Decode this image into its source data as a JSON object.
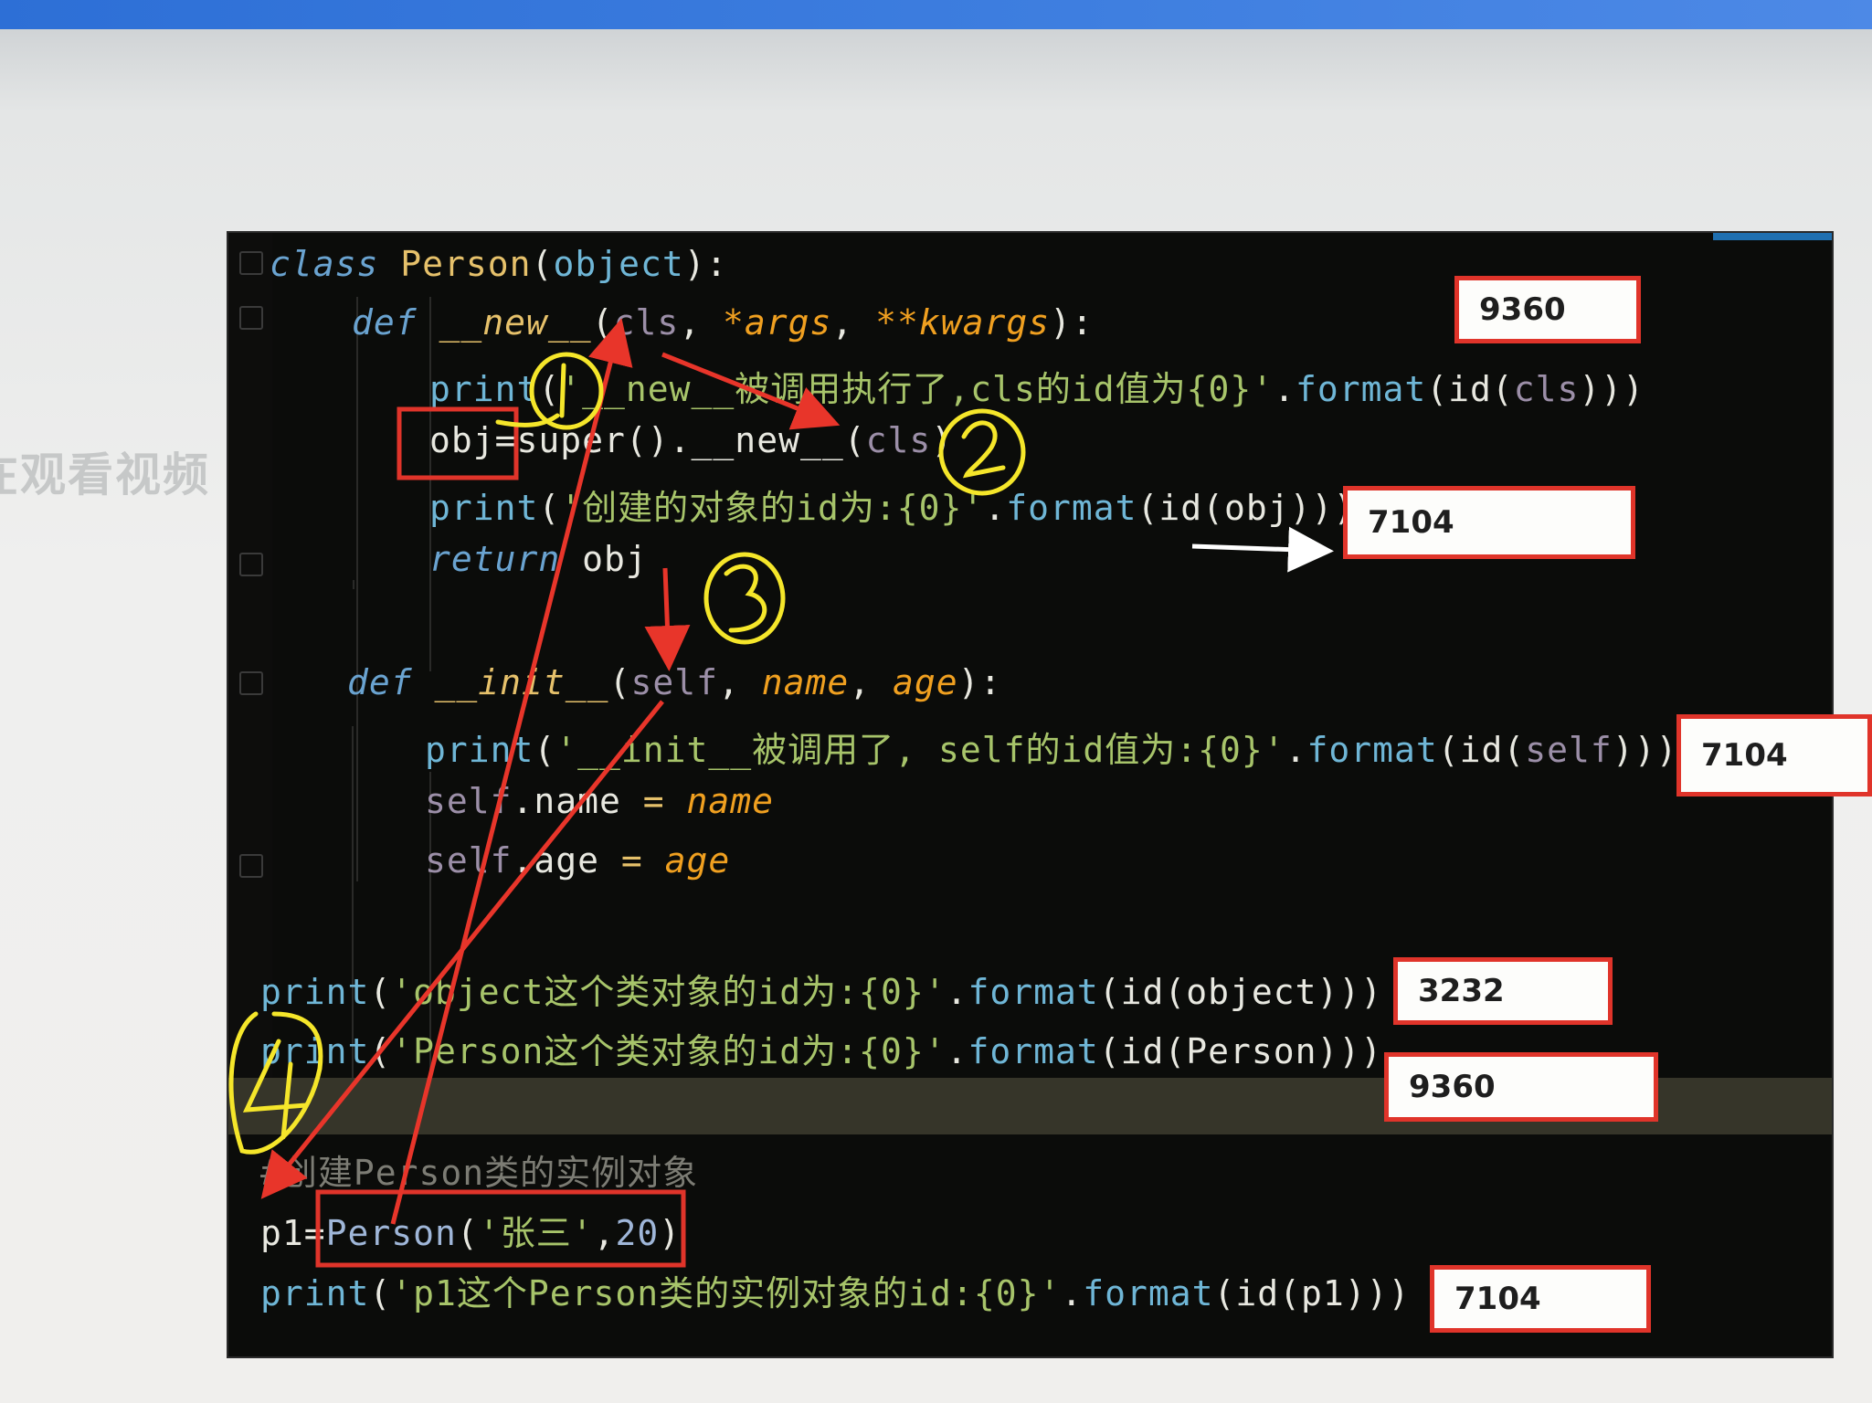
{
  "side_caption": "在观看视频",
  "code": {
    "l1": {
      "kw": "class",
      "name": "Person",
      "open": "(",
      "base": "object",
      "close": "):"
    },
    "l2": {
      "kw": "def",
      "fn": "__new__",
      "open": "(",
      "p1": "cls",
      "comma1": ", ",
      "p2": "*args",
      "comma2": ", ",
      "p3": "**kwargs",
      "close": "):"
    },
    "l3": {
      "print": "print",
      "open": "(",
      "str": "'__new__被调用执行了,cls的id值为{0}'",
      "dot": ".",
      "fmt": "format",
      "mid": "(id(",
      "arg": "cls",
      "close": ")))"
    },
    "l4": {
      "lhs": "obj",
      "eq": "=",
      "rhs": "super().__new__(",
      "arg": "cls",
      "close": ")"
    },
    "l5": {
      "print": "print",
      "open": "(",
      "str": "'创建的对象的id为:{0}'",
      "dot": ".",
      "fmt": "format",
      "mid": "(id(obj)))"
    },
    "l6": {
      "kw": "return",
      "rest": " obj"
    },
    "l7": {
      "kw": "def",
      "fn": "__init__",
      "open": "(",
      "p1": "self",
      "comma1": ", ",
      "p2": "name",
      "comma2": ", ",
      "p3": "age",
      "close": "):"
    },
    "l8": {
      "print": "print",
      "open": "(",
      "str": "'__init__被调用了, self的id值为:{0}'",
      "dot": ".",
      "fmt": "format",
      "mid": "(id(",
      "arg": "self",
      "close": ")))"
    },
    "l9": {
      "self": "self",
      "attr": ".name",
      "eq": " = ",
      "val": "name"
    },
    "l10": {
      "self": "self",
      "attr": ".age",
      "eq": " = ",
      "val": "age"
    },
    "l11": {
      "print": "print",
      "open": "(",
      "str": "'object这个类对象的id为:{0}'",
      "dot": ".",
      "fmt": "format",
      "mid": "(id(object)))"
    },
    "l12": {
      "print": "print",
      "open": "(",
      "str": "'Person这个类对象的id为:{0}'",
      "dot": ".",
      "fmt": "format",
      "mid": "(id(Person)))"
    },
    "l13": {
      "comment": "#创建Person类的实例对象"
    },
    "l14": {
      "lhs": "p1",
      "eq": "=",
      "cls": "Person",
      "open": "(",
      "str": "'张三'",
      "comma": ",",
      "num": "20",
      "close": ")"
    },
    "l15": {
      "print": "print",
      "open": "(",
      "str": "'p1这个Person类的实例对象的id:{0}'",
      "dot": ".",
      "fmt": "format",
      "mid": "(id(p1)))"
    }
  },
  "id_boxes": {
    "b1": "9360",
    "b2": "7104",
    "b3": "7104",
    "b4": "3232",
    "b5": "9360",
    "b6": "7104"
  },
  "step_marks": [
    "1",
    "2",
    "3",
    "4"
  ],
  "colors": {
    "box_border": "#e0342a",
    "arrow_red": "#e8352a",
    "marker_yellow": "#f5e62a",
    "editor_bg": "#0b0c0a"
  }
}
